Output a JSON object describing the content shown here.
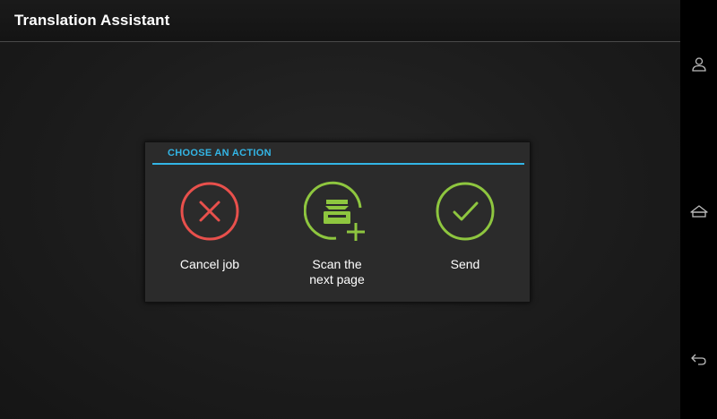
{
  "app": {
    "title": "Translation Assistant"
  },
  "dialog": {
    "title": "CHOOSE AN ACTION",
    "accent_color": "#33b5e5",
    "actions": [
      {
        "label": "Cancel job",
        "icon": "cancel-x-icon",
        "color": "#e8504c"
      },
      {
        "label": "Scan the\nnext page",
        "icon": "scanner-add-icon",
        "color": "#8ec63f"
      },
      {
        "label": "Send",
        "icon": "check-icon",
        "color": "#8ec63f"
      }
    ]
  },
  "navbar": {
    "buttons": [
      {
        "icon": "user-icon"
      },
      {
        "icon": "home-icon"
      },
      {
        "icon": "back-icon"
      }
    ]
  }
}
